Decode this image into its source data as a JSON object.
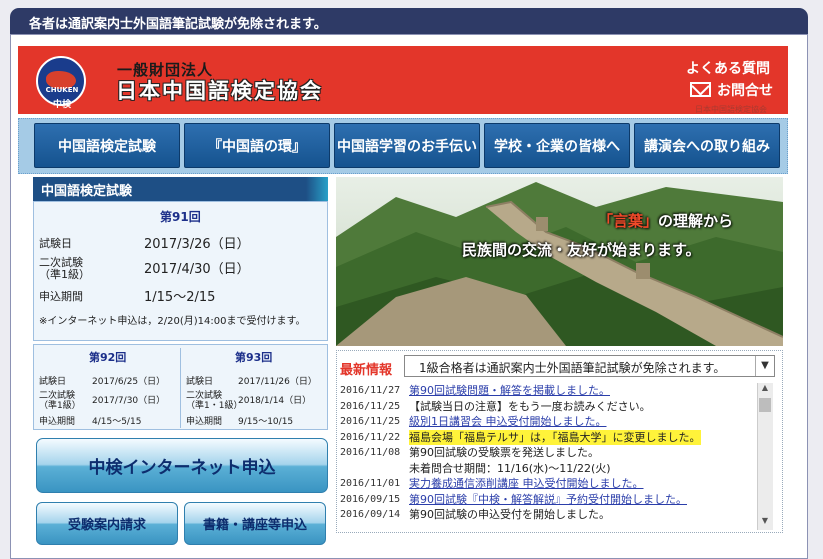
{
  "topbar": {
    "text": "各者は通訳案内士外国語筆記試験が免除されます。"
  },
  "header": {
    "logo_text": "CHUKEN",
    "logo_caption": "中検",
    "org_sub": "一般財団法人",
    "org_name": "日本中国語検定協会",
    "faq": "よくある質問",
    "contact": "お問合せ",
    "tiny_link": "日本中国語検定協会"
  },
  "nav": [
    {
      "label": "中国語検定試験"
    },
    {
      "label": "『中国語の環』"
    },
    {
      "label": "中国語学習のお手伝い"
    },
    {
      "label": "学校・企業の皆様へ"
    },
    {
      "label": "講演会への取り組み"
    }
  ],
  "schedule": {
    "title": "中国語検定試験",
    "current": {
      "round": "第91回",
      "exam_label": "試験日",
      "exam_date": "2017/3/26（日）",
      "second_label": "二次試験",
      "second_sub": "（準1級）",
      "second_date": "2017/4/30（日）",
      "apply_label": "申込期間",
      "apply_period": "1/15～2/15",
      "note": "※インターネット申込は，2/20(月)14:00まで受付けます。"
    },
    "next": [
      {
        "round": "第92回",
        "exam_label": "試験日",
        "exam_date": "2017/6/25（日）",
        "second_label": "二次試験",
        "second_sub": "（準1級）",
        "second_date": "2017/7/30（日）",
        "apply_label": "申込期間",
        "apply_period": "4/15～5/15"
      },
      {
        "round": "第93回",
        "exam_label": "試験日",
        "exam_date": "2017/11/26（日）",
        "second_label": "二次試験",
        "second_sub": "（準1・1級）",
        "second_date": "2018/1/14（日）",
        "apply_label": "申込期間",
        "apply_period": "9/15～10/15"
      }
    ]
  },
  "buttons": {
    "internet_apply": "中検インターネット申込",
    "guide_request": "受験案内請求",
    "books": "書籍・講座等申込"
  },
  "hero": {
    "line1_em": "「言葉」",
    "line1_rest": "の理解から",
    "line2": "民族間の交流・友好が始まります。"
  },
  "news": {
    "label": "最新情報",
    "select_value": "1級合格者は通訳案内士外国語筆記試験が免除されます。",
    "items": [
      {
        "date": "2016/11/27",
        "text": "第90回試験問題・解答を掲載しました。",
        "link": true,
        "highlight": false
      },
      {
        "date": "2016/11/25",
        "text": "【試験当日の注意】をもう一度お読みください。",
        "link": false,
        "highlight": false
      },
      {
        "date": "2016/11/25",
        "text": "級別1日講習会 申込受付開始しました。",
        "link": true,
        "highlight": false
      },
      {
        "date": "2016/11/22",
        "text": "福島会場「福島テルサ」は，「福島大学」に変更しました。",
        "link": false,
        "highlight": true
      },
      {
        "date": "2016/11/08",
        "text": "第90回試験の受験票を発送しました。",
        "text2": "未着問合せ期間：11/16(水)～11/22(火)",
        "link": false,
        "highlight": false
      },
      {
        "date": "2016/11/01",
        "text": "実力養成通信添削講座 申込受付開始しました。",
        "link": true,
        "highlight": false
      },
      {
        "date": "2016/09/15",
        "text": "第90回試験『中検・解答解説』予約受付開始しました。",
        "link": true,
        "highlight": false
      },
      {
        "date": "2016/09/14",
        "text": "第90回試験の申込受付を開始しました。",
        "link": false,
        "highlight": false
      }
    ]
  },
  "colors": {
    "header_red": "#e3362a",
    "nav_blue": "#1f5f9e",
    "topbar_navy": "#2e3a66",
    "highlight_yellow": "#fff33a"
  },
  "icons": [
    "mail-icon",
    "chevron-down-icon",
    "logo-globe-icon"
  ]
}
